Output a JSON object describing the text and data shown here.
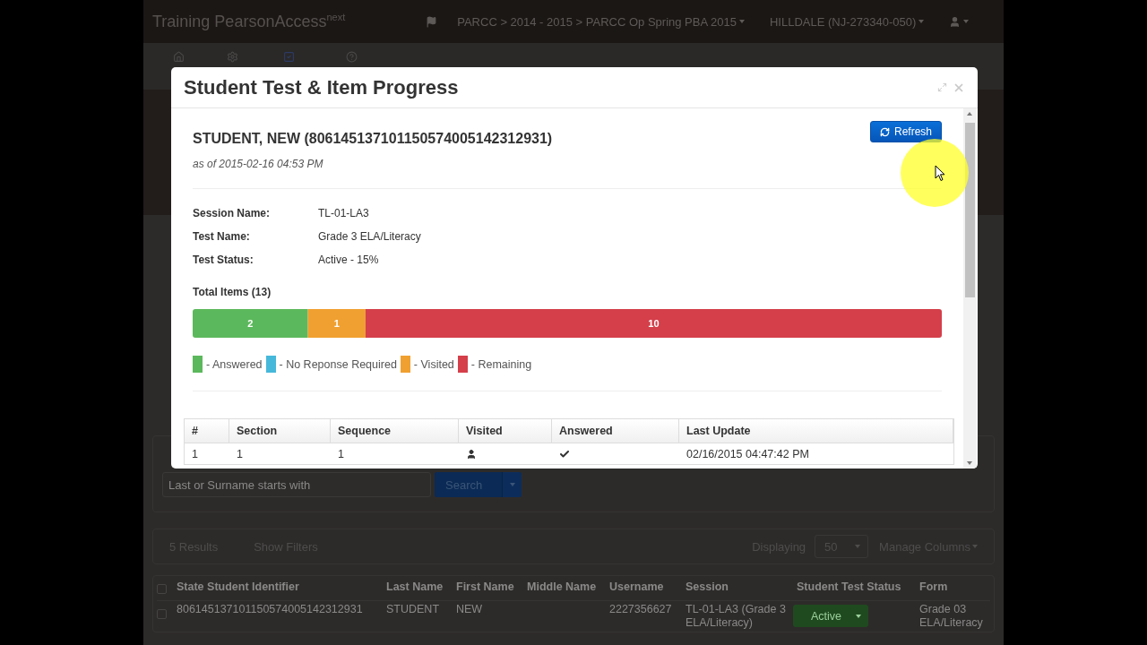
{
  "navbar": {
    "brand": "Training PearsonAccess$^{next}$",
    "breadcrumb": "PARCC > 2014 - 2015 > PARCC Op Spring PBA 2015",
    "organization": "HILLDALE (NJ-273340-050)"
  },
  "search": {
    "placeholder": "Last or Surname starts with",
    "button": "Search"
  },
  "results_bar": {
    "count": "5 Results",
    "filters_link": "Show Filters",
    "displaying_label": "Displaying",
    "page_size": "50",
    "manage_columns": "Manage Columns"
  },
  "students_table": {
    "all_checked": false,
    "columns": [
      "State Student Identifier",
      "Last Name",
      "First Name",
      "Middle Name",
      "Username",
      "Session",
      "Student Test Status",
      "Form"
    ],
    "rows": [
      {
        "id": "806145137101150574005142312931",
        "last_name": "STUDENT",
        "first_name": "NEW",
        "username": "2227356627",
        "session": "TL-01-LA3 (Grade 3 ELA/Literacy)",
        "status": "Active",
        "form": "Grade 03 ELA/Literacy",
        "checked": false
      }
    ]
  },
  "modal": {
    "title": "Student Test & Item Progress",
    "student": "STUDENT, NEW (806145137101150574005142312931)",
    "as_of": "as of 2015-02-16 04:53 PM",
    "refresh_button": "Refresh",
    "details": [
      {
        "label": "Session Name:",
        "value": "TL-01-LA3"
      },
      {
        "label": "Test Name:",
        "value": "Grade 3 ELA/Literacy"
      },
      {
        "label": "Test Status:",
        "value": "Active - 15%"
      }
    ],
    "total_items": "Total Items (13)",
    "progress_chart": {
      "chart_data": {
        "type": "bar",
        "orientation": "horizontal",
        "stacked": true,
        "xlim": [
          0,
          13
        ],
        "data_labels": true,
        "series": [
          {
            "color": "#5cb85c",
            "values": [
              2
            ]
          },
          {
            "color": "#f0a030",
            "values": [
              1
            ]
          },
          {
            "color": "#d43f4a",
            "values": [
              10
            ]
          }
        ]
      }
    },
    "legend": [
      {
        "label": "- Answered",
        "color": "#5cb85c"
      },
      {
        "label": "- No Reponse Required",
        "color": "#46b8da"
      },
      {
        "label": "- Visited",
        "color": "#f0a030"
      },
      {
        "label": "- Remaining",
        "color": "#d43f4a"
      }
    ],
    "items_table": {
      "columns": [
        "#",
        "Section",
        "Sequence",
        "Visited",
        "Answered",
        "Last Update"
      ],
      "rows": [
        {
          "number": "1",
          "section": "1",
          "sequence": "1",
          "visited": true,
          "answered": true,
          "last_update": "02/16/2015 04:47:42 PM"
        }
      ]
    }
  }
}
